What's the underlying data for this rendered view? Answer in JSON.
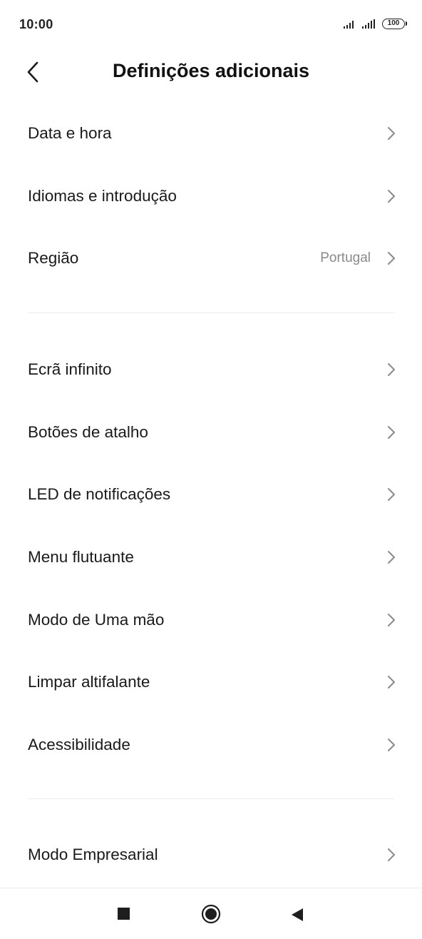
{
  "status_bar": {
    "time": "10:00",
    "battery": "100",
    "icons": [
      "signal-icon",
      "signal-icon",
      "battery-icon"
    ]
  },
  "header": {
    "title": "Definições adicionais",
    "back_icon": "chevron-left-icon"
  },
  "groups": [
    {
      "items": [
        {
          "label": "Data e hora",
          "value": ""
        },
        {
          "label": "Idiomas e introdução",
          "value": ""
        },
        {
          "label": "Região",
          "value": "Portugal"
        }
      ]
    },
    {
      "items": [
        {
          "label": "Ecrã infinito",
          "value": ""
        },
        {
          "label": "Botões de atalho",
          "value": ""
        },
        {
          "label": "LED de notificações",
          "value": ""
        },
        {
          "label": "Menu flutuante",
          "value": ""
        },
        {
          "label": "Modo de Uma mão",
          "value": ""
        },
        {
          "label": "Limpar altifalante",
          "value": ""
        },
        {
          "label": "Acessibilidade",
          "value": ""
        }
      ]
    },
    {
      "items": [
        {
          "label": "Modo Empresarial",
          "value": ""
        }
      ]
    }
  ],
  "nav_bar": {
    "icons": [
      "recents-square-icon",
      "home-circle-icon",
      "back-triangle-icon"
    ]
  }
}
